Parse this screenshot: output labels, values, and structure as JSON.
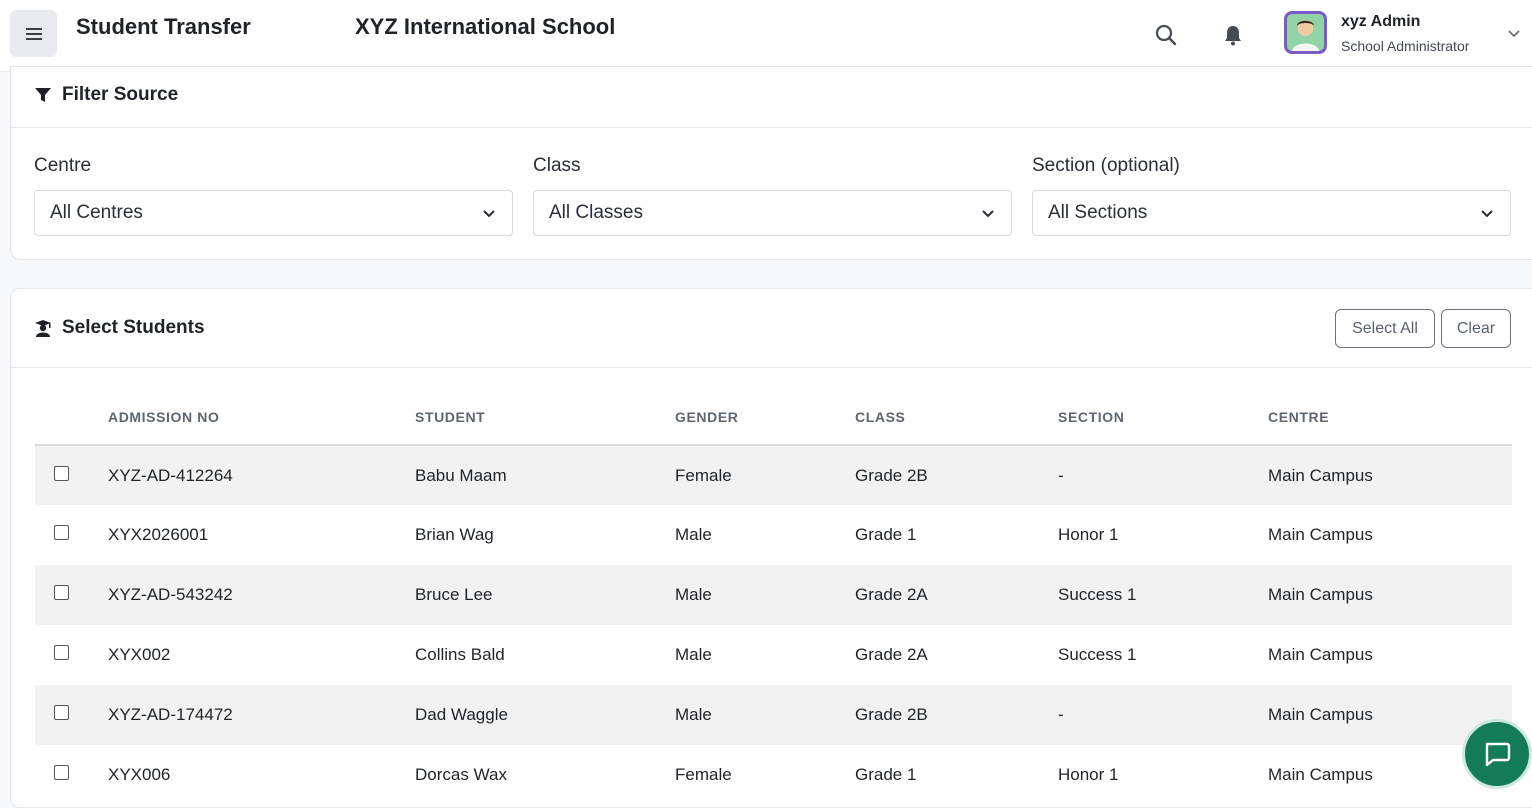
{
  "header": {
    "page_title": "Student Transfer",
    "school_name": "XYZ International School",
    "user_name": "xyz Admin",
    "user_role": "School Administrator"
  },
  "filter": {
    "heading": "Filter Source",
    "centre_label": "Centre",
    "centre_value": "All Centres",
    "class_label": "Class",
    "class_value": "All Classes",
    "section_label": "Section (optional)",
    "section_value": "All Sections"
  },
  "students": {
    "heading": "Select Students",
    "select_all_label": "Select All",
    "clear_label": "Clear",
    "columns": [
      "ADMISSION NO",
      "STUDENT",
      "GENDER",
      "CLASS",
      "SECTION",
      "CENTRE"
    ],
    "rows": [
      {
        "admission_no": "XYZ-AD-412264",
        "student": "Babu Maam",
        "gender": "Female",
        "class": "Grade 2B",
        "section": "-",
        "centre": "Main Campus"
      },
      {
        "admission_no": "XYX2026001",
        "student": "Brian Wag",
        "gender": "Male",
        "class": "Grade 1",
        "section": "Honor 1",
        "centre": "Main Campus"
      },
      {
        "admission_no": "XYZ-AD-543242",
        "student": "Bruce Lee",
        "gender": "Male",
        "class": "Grade 2A",
        "section": "Success 1",
        "centre": "Main Campus"
      },
      {
        "admission_no": "XYX002",
        "student": "Collins Bald",
        "gender": "Male",
        "class": "Grade 2A",
        "section": "Success 1",
        "centre": "Main Campus"
      },
      {
        "admission_no": "XYZ-AD-174472",
        "student": "Dad Waggle",
        "gender": "Male",
        "class": "Grade 2B",
        "section": "-",
        "centre": "Main Campus"
      },
      {
        "admission_no": "XYX006",
        "student": "Dorcas Wax",
        "gender": "Female",
        "class": "Grade 1",
        "section": "Honor 1",
        "centre": "Main Campus"
      }
    ]
  },
  "icons": {
    "menu": "menu-icon",
    "search": "search-icon",
    "notifications": "bell-icon",
    "filter": "filter-icon",
    "students": "graduate-icon",
    "chat": "chat-icon"
  },
  "colors": {
    "chat_fab": "#137b58",
    "avatar_bg": "#7b5cc7",
    "row_stripe": "#f2f2f2"
  }
}
